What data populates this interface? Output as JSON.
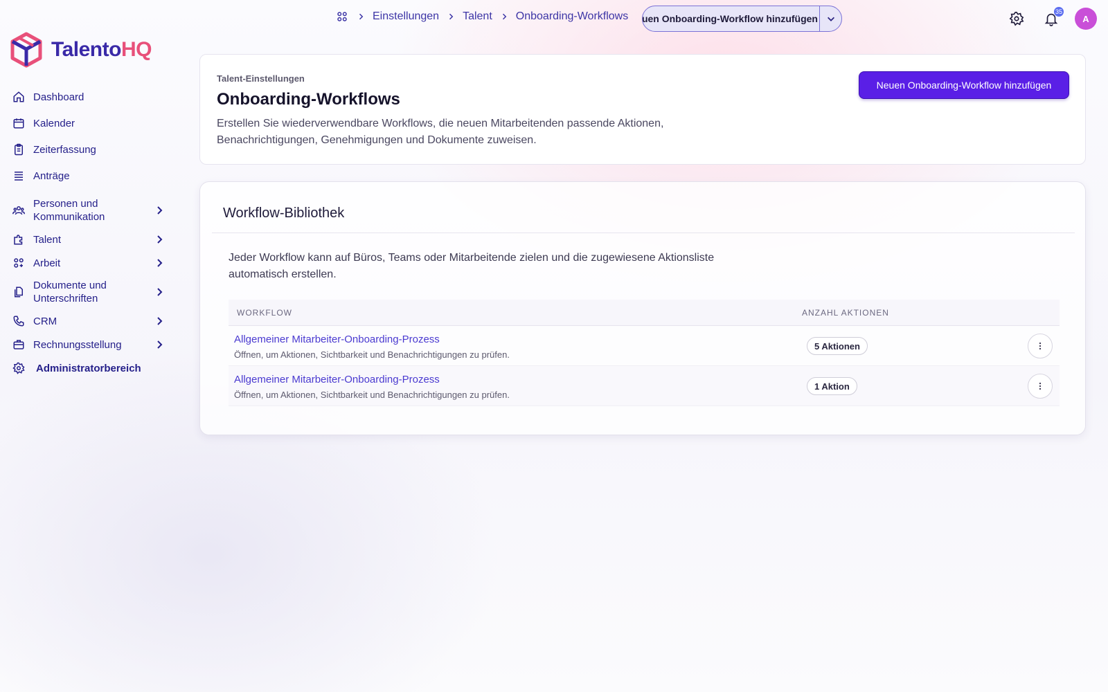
{
  "brand": {
    "part1": "Talento",
    "part2": "HQ"
  },
  "sidebar": {
    "items": [
      {
        "label": "Dashboard",
        "icon": "home-icon",
        "chevron": false
      },
      {
        "label": "Kalender",
        "icon": "calendar-icon",
        "chevron": false
      },
      {
        "label": "Zeiterfassung",
        "icon": "clipboard-icon",
        "chevron": false
      },
      {
        "label": "Anträge",
        "icon": "list-icon",
        "chevron": false
      },
      {
        "label": "Personen und Kommunikation",
        "icon": "people-icon",
        "chevron": true
      },
      {
        "label": "Talent",
        "icon": "puzzle-icon",
        "chevron": true
      },
      {
        "label": "Arbeit",
        "icon": "grid-icon",
        "chevron": true
      },
      {
        "label": "Dokumente und Unterschriften",
        "icon": "documents-icon",
        "chevron": true
      },
      {
        "label": "CRM",
        "icon": "phone-icon",
        "chevron": true
      },
      {
        "label": "Rechnungsstellung",
        "icon": "briefcase-icon",
        "chevron": true
      },
      {
        "label": "Administratorbereich",
        "icon": "gear-icon",
        "chevron": false
      }
    ]
  },
  "topbar": {
    "breadcrumbs": [
      "Einstellungen",
      "Talent",
      "Onboarding-Workflows"
    ],
    "split_button_label": "Neuen Onboarding-Workflow hinzufügen",
    "notification_count": "35",
    "avatar_initial": "A"
  },
  "header_card": {
    "eyebrow": "Talent-Einstellungen",
    "title": "Onboarding-Workflows",
    "description": "Erstellen Sie wiederverwendbare Workflows, die neuen Mitarbeitenden passende Aktionen, Benachrichtigungen, Genehmigungen und Dokumente zuweisen.",
    "primary_button": "Neuen Onboarding-Workflow hinzufügen"
  },
  "library": {
    "title": "Workflow-Bibliothek",
    "intro": "Jeder Workflow kann auf Büros, Teams oder Mitarbeitende zielen und die zugewiesene Aktionsliste automatisch erstellen.",
    "columns": [
      "WORKFLOW",
      "ANZAHL AKTIONEN"
    ],
    "rows": [
      {
        "name": "Allgemeiner Mitarbeiter-Onboarding-Prozess",
        "subtitle": "Öffnen, um Aktionen, Sichtbarkeit und Benachrichtigungen zu prüfen.",
        "count": "5 Aktionen"
      },
      {
        "name": "Allgemeiner Mitarbeiter-Onboarding-Prozess",
        "subtitle": "Öffnen, um Aktionen, Sichtbarkeit und Benachrichtigungen zu prüfen.",
        "count": "1 Aktion"
      }
    ]
  },
  "colors": {
    "accent": "#5a1fe6",
    "nav_text": "#25208a",
    "link": "#4a3ad0",
    "brand_pink": "#e8507a",
    "brand_indigo": "#3a2aa8"
  }
}
